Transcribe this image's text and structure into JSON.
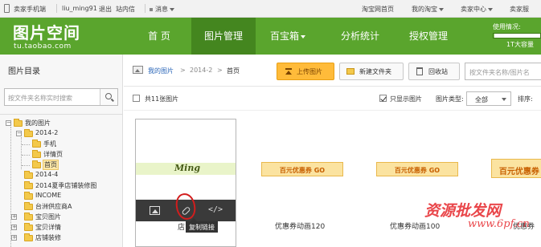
{
  "topbar": {
    "phone": "卖家手机端",
    "user": "liu_ming91",
    "logout": "退出",
    "inbox": "站内信",
    "msg": "消息",
    "taobao_home": "淘宝网首页",
    "my_taobao": "我的淘宝",
    "seller_center": "卖家中心",
    "seller_service": "卖家服"
  },
  "header": {
    "logo_title": "图片空间",
    "logo_sub": "tu.taobao.com",
    "nav": [
      "首  页",
      "图片管理",
      "百宝箱",
      "分析统计",
      "授权管理"
    ],
    "active_index": 1,
    "usage_label": "使用情况:",
    "usage_capacity": "1T大容量",
    "usage_fraction": 0.02
  },
  "sidebar": {
    "title": "图片目录",
    "search_placeholder": "按文件夹名称实时搜索",
    "tree": [
      {
        "label": "我的图片",
        "expander": "−",
        "level": 0
      },
      {
        "label": "2014-2",
        "expander": "−",
        "level": 1
      },
      {
        "label": "手机",
        "expander": "",
        "level": 2
      },
      {
        "label": "详情页",
        "expander": "",
        "level": 2
      },
      {
        "label": "首页",
        "expander": "",
        "level": 2,
        "selected": true
      },
      {
        "label": "2014-4",
        "expander": "",
        "level": 1
      },
      {
        "label": "2014夏季店铺装修图",
        "expander": "",
        "level": 1
      },
      {
        "label": "INCOME",
        "expander": "",
        "level": 1
      },
      {
        "label": "台洲供应商A",
        "expander": "",
        "level": 1
      },
      {
        "label": "宝贝图片",
        "expander": "+",
        "level": 1
      },
      {
        "label": "宝贝详情",
        "expander": "+",
        "level": 1
      },
      {
        "label": "店铺装修",
        "expander": "+",
        "level": 1
      }
    ]
  },
  "main": {
    "breadcrumb": [
      "我的图片",
      ">",
      "2014-2",
      ">",
      "首页"
    ],
    "upload_btn": "上传图片",
    "new_folder_btn": "新建文件夹",
    "recycle_btn": "回收站",
    "search_placeholder": "按文件夹名称/图片名",
    "total": "共11张图片",
    "only_show": "只显示图片",
    "type_label": "图片类型:",
    "type_value": "全部",
    "sort_label": "排序:"
  },
  "cards": [
    {
      "name": "店",
      "banner_text": "Ming",
      "tooltip": "复制链接"
    },
    {
      "name": "优惠券动画120",
      "coupon": "百元优惠券 GO"
    },
    {
      "name": "优惠券动画100",
      "coupon": "百元优惠券 GO"
    },
    {
      "name": "优惠券",
      "coupon": "百元优惠券 GO"
    }
  ],
  "watermark": {
    "text": "资源批发网",
    "url": "www.6pf.cn"
  },
  "colors": {
    "header_green": "#5aa52d",
    "nav_active": "#44861f",
    "upload_orange": "#ffbb3a",
    "link_blue": "#2a66b8",
    "watermark_red": "#e6262b"
  }
}
